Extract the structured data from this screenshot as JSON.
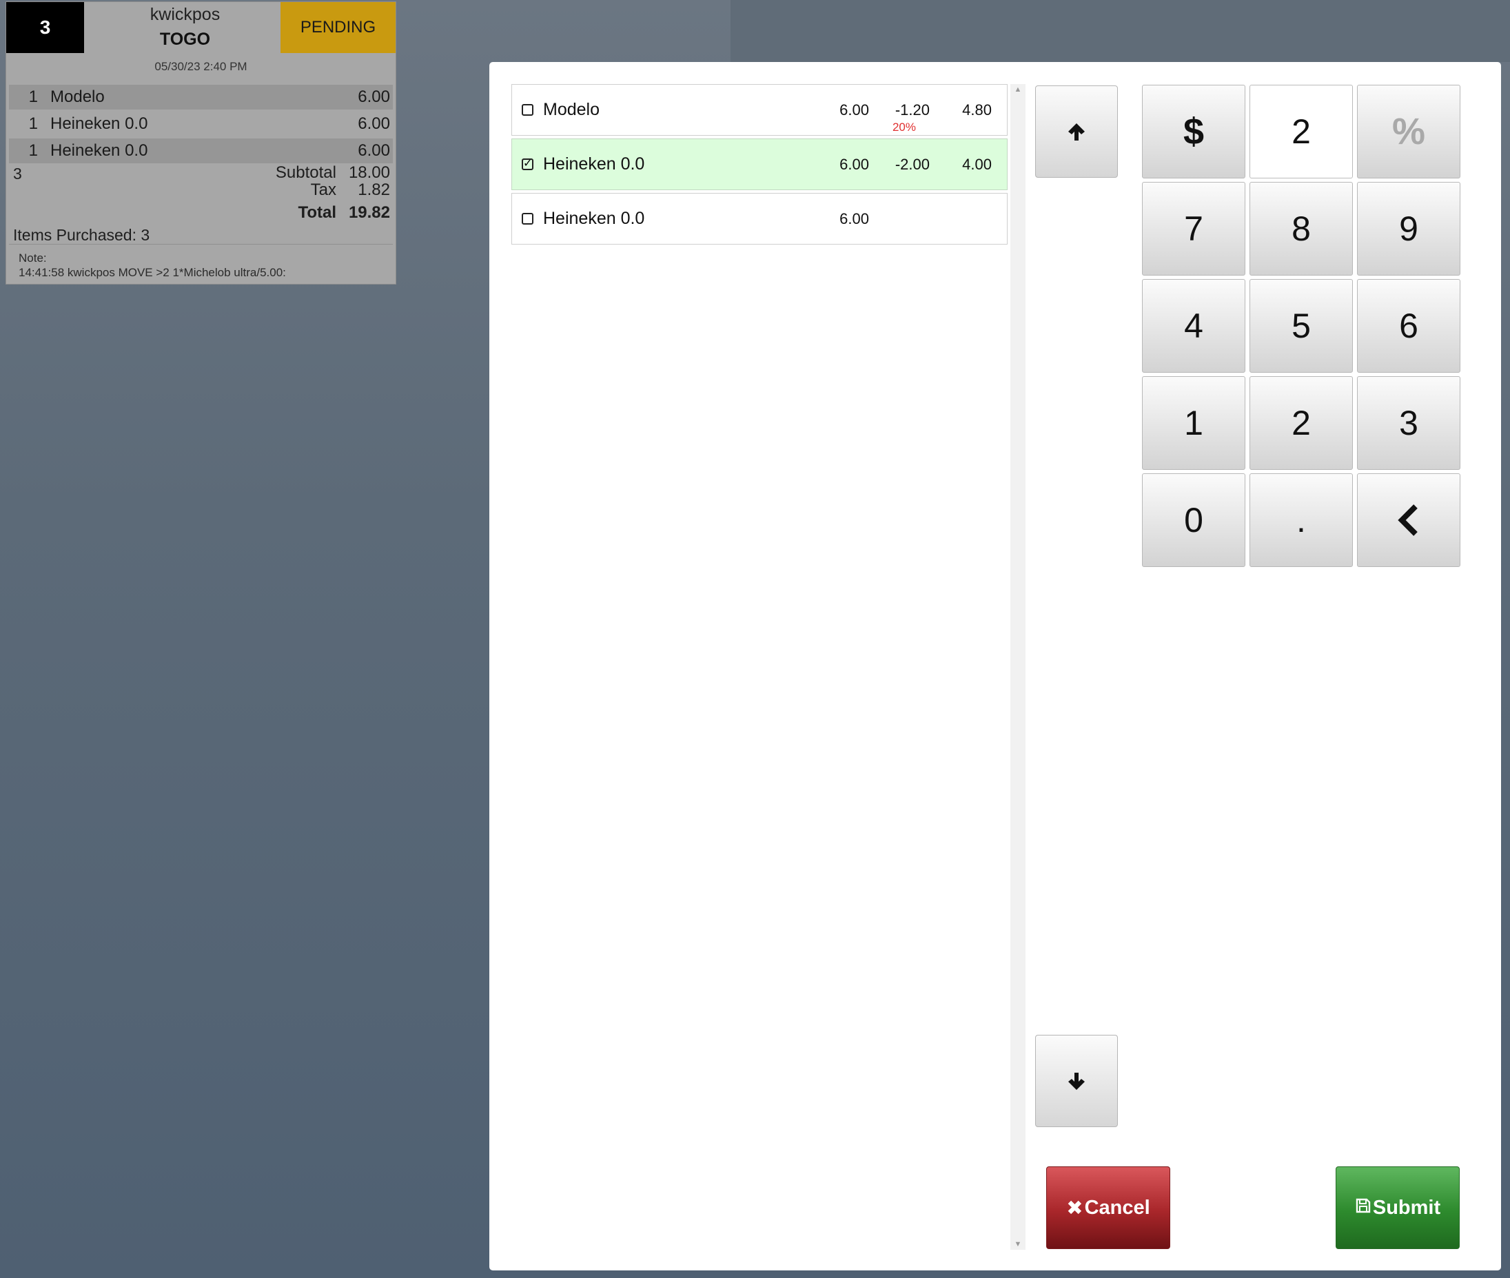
{
  "ticket": {
    "number": "3",
    "user": "kwickpos",
    "order_type": "TOGO",
    "status": "PENDING",
    "status_color": "#c99a10",
    "datetime": "05/30/23 2:40 PM",
    "items": [
      {
        "qty": "1",
        "name": "Modelo",
        "price": "6.00"
      },
      {
        "qty": "1",
        "name": "Heineken 0.0",
        "price": "6.00"
      },
      {
        "qty": "1",
        "name": "Heineken 0.0",
        "price": "6.00"
      }
    ],
    "item_count": "3",
    "subtotal_label": "Subtotal",
    "subtotal": "18.00",
    "tax_label": "Tax",
    "tax": "1.82",
    "total_label": "Total",
    "total": "19.82",
    "items_purchased": "Items Purchased: 3",
    "note_label": "Note:",
    "note_text": "14:41:58 kwickpos MOVE >2 1*Michelob ultra/5.00:"
  },
  "discount_list": [
    {
      "name": "Modelo",
      "price": "6.00",
      "discount": "-1.20",
      "discount_pct": "20%",
      "total": "4.80",
      "checked": false
    },
    {
      "name": "Heineken 0.0",
      "price": "6.00",
      "discount": "-2.00",
      "discount_pct": "",
      "total": "4.00",
      "checked": true
    },
    {
      "name": "Heineken 0.0",
      "price": "6.00",
      "discount": "",
      "discount_pct": "",
      "total": "",
      "checked": false
    }
  ],
  "keypad": {
    "dollar": "$",
    "display_value": "2",
    "percent": "%",
    "keys": [
      "7",
      "8",
      "9",
      "4",
      "5",
      "6",
      "1",
      "2",
      "3",
      "0",
      ".",
      "‹"
    ]
  },
  "actions": {
    "cancel_label": "Cancel",
    "submit_label": "Submit",
    "cancel_color": "#a8262a",
    "submit_color": "#2d8a2d"
  },
  "icons": {
    "scroll_up": "arrow-up-icon",
    "scroll_down": "arrow-down-icon",
    "backspace": "chevron-left-icon",
    "cancel": "times-icon",
    "submit": "floppy-disk-icon"
  }
}
